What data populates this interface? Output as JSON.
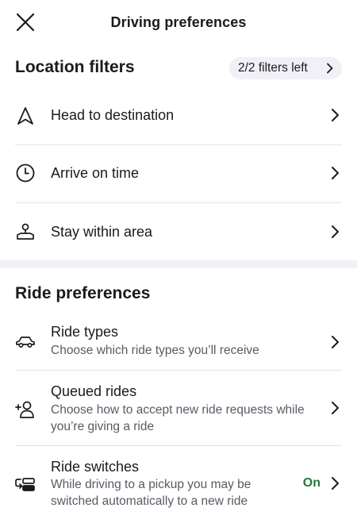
{
  "header": {
    "title": "Driving preferences",
    "close_icon": "close-icon"
  },
  "location_filters": {
    "title": "Location filters",
    "pill_label": "2/2 filters left",
    "items": [
      {
        "label": "Head to destination",
        "icon": "navigation-arrow-icon"
      },
      {
        "label": "Arrive on time",
        "icon": "clock-icon"
      },
      {
        "label": "Stay within area",
        "icon": "map-pin-area-icon"
      }
    ]
  },
  "ride_preferences": {
    "title": "Ride preferences",
    "items": [
      {
        "label": "Ride types",
        "sub": "Choose which ride types you’ll receive",
        "icon": "car-icon"
      },
      {
        "label": "Queued rides",
        "sub": "Choose how to accept new ride requests while you’re giving a ride",
        "icon": "add-person-icon"
      },
      {
        "label": "Ride switches",
        "sub": "While driving to a pickup you may be switched automatically to a new ride",
        "icon": "switch-car-icon",
        "status": "On"
      }
    ]
  },
  "colors": {
    "status_on": "#1f7a37",
    "pill_bg": "#f1f0f6",
    "divider": "#e3e3e8"
  }
}
